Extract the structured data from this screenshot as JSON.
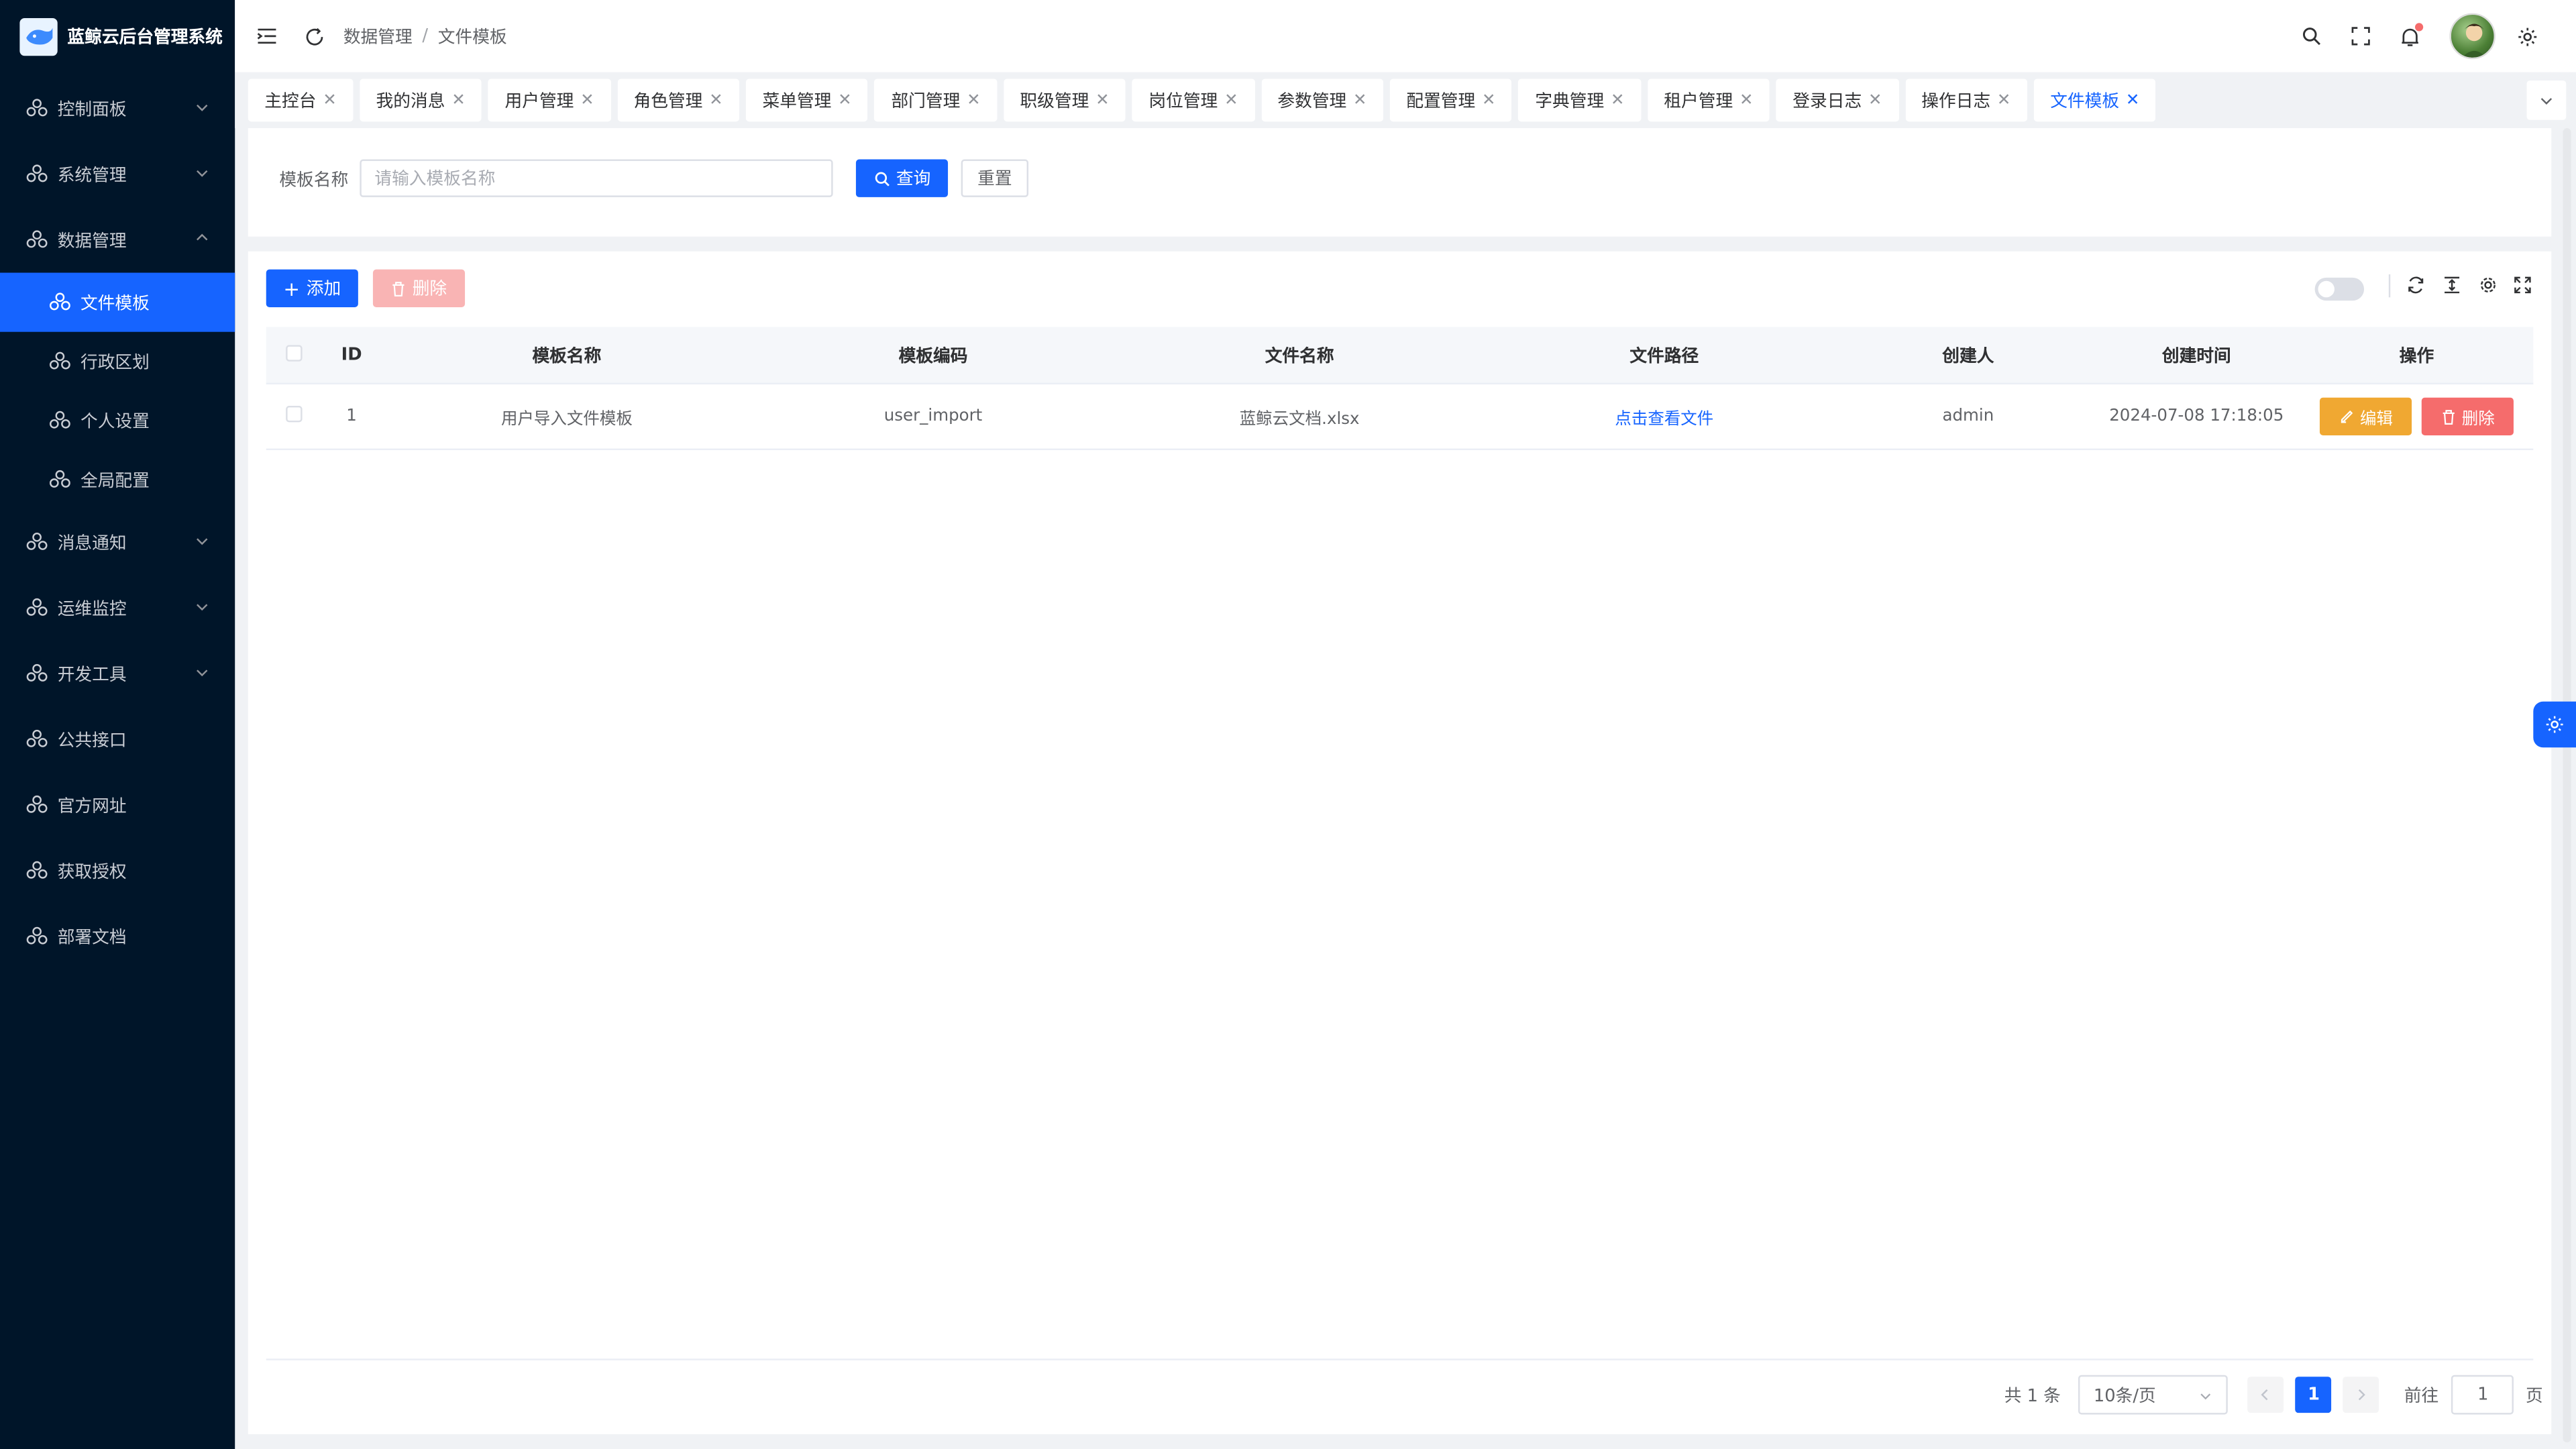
{
  "app": {
    "title": "蓝鲸云后台管理系统"
  },
  "sidebar": {
    "items": [
      {
        "label": "控制面板"
      },
      {
        "label": "系统管理"
      },
      {
        "label": "数据管理"
      },
      {
        "label": "消息通知"
      },
      {
        "label": "运维监控"
      },
      {
        "label": "开发工具"
      },
      {
        "label": "公共接口"
      },
      {
        "label": "官方网址"
      },
      {
        "label": "获取授权"
      },
      {
        "label": "部署文档"
      }
    ],
    "sub": [
      {
        "label": "文件模板"
      },
      {
        "label": "行政区划"
      },
      {
        "label": "个人设置"
      },
      {
        "label": "全局配置"
      }
    ]
  },
  "header": {
    "breadcrumb": [
      "数据管理",
      "文件模板"
    ],
    "separator": "/"
  },
  "tabs": [
    {
      "label": "主控台"
    },
    {
      "label": "我的消息"
    },
    {
      "label": "用户管理"
    },
    {
      "label": "角色管理"
    },
    {
      "label": "菜单管理"
    },
    {
      "label": "部门管理"
    },
    {
      "label": "职级管理"
    },
    {
      "label": "岗位管理"
    },
    {
      "label": "参数管理"
    },
    {
      "label": "配置管理"
    },
    {
      "label": "字典管理"
    },
    {
      "label": "租户管理"
    },
    {
      "label": "登录日志"
    },
    {
      "label": "操作日志"
    },
    {
      "label": "文件模板"
    }
  ],
  "search": {
    "label": "模板名称",
    "placeholder": "请输入模板名称",
    "query_label": "查询",
    "reset_label": "重置"
  },
  "toolbar": {
    "add_label": "添加",
    "delete_label": "删除"
  },
  "table": {
    "headers": [
      "ID",
      "模板名称",
      "模板编码",
      "文件名称",
      "文件路径",
      "创建人",
      "创建时间",
      "操作"
    ],
    "rows": [
      {
        "id": "1",
        "name": "用户导入文件模板",
        "code": "user_import",
        "file_name": "蓝鲸云文档.xlsx",
        "file_path": "点击查看文件",
        "creator": "admin",
        "created": "2024-07-08 17:18:05",
        "edit_label": "编辑",
        "delete_label": "删除"
      }
    ]
  },
  "pagination": {
    "total": "共 1 条",
    "page_size": "10条/页",
    "current_page": "1",
    "goto_label": "前往",
    "goto_value": "1",
    "page_suffix": "页"
  },
  "colors": {
    "primary": "#1664ff",
    "sidebar": "#001529",
    "warning": "#f0a832",
    "danger": "#f56c6c"
  }
}
